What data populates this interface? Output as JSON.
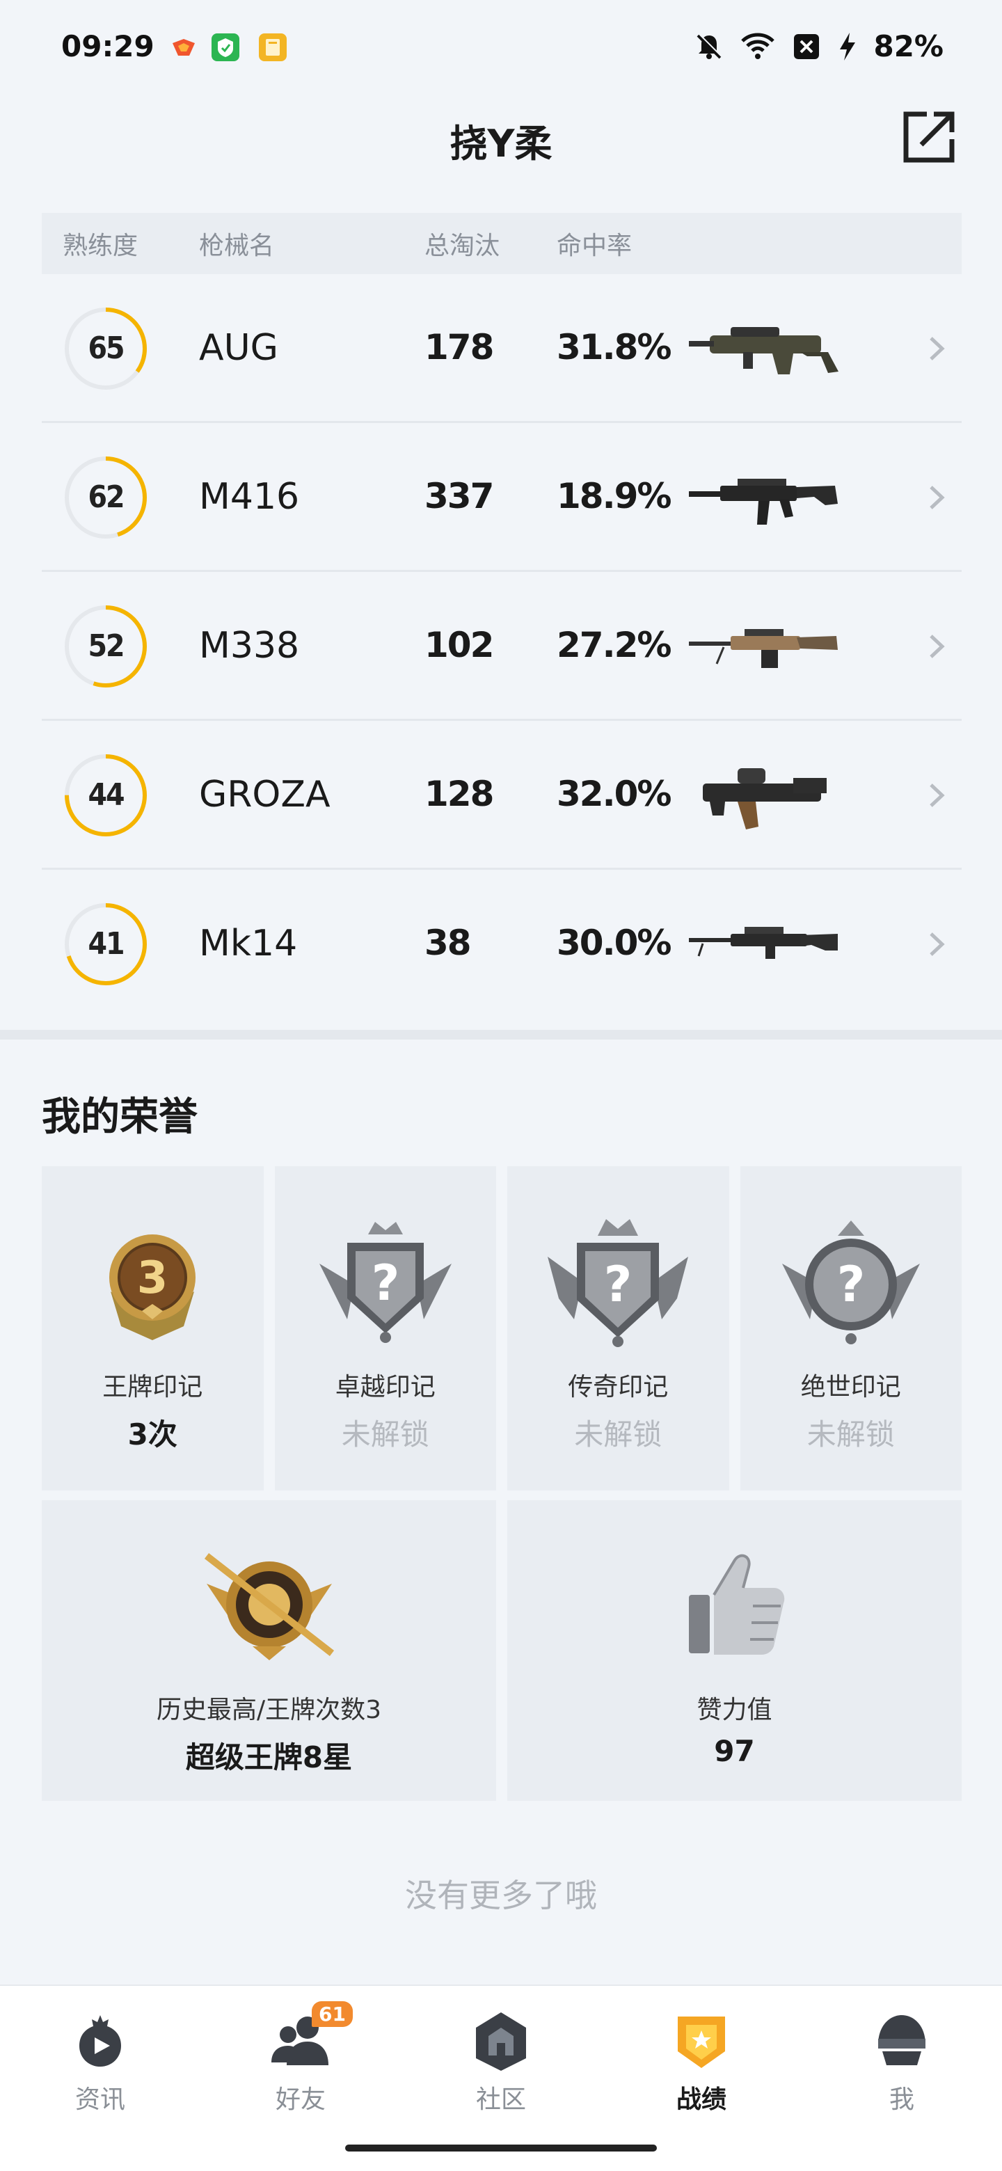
{
  "status_bar": {
    "time": "09:29",
    "battery": "82%",
    "icons": [
      "game-app-icon",
      "security-app-icon",
      "book-app-icon",
      "mute-icon",
      "wifi-icon",
      "sim-icon",
      "charging-icon"
    ]
  },
  "header": {
    "title": "挠Y柔",
    "share_icon": "share-icon"
  },
  "weapon_table": {
    "headers": [
      "熟练度",
      "枪械名",
      "总淘汰",
      "命中率"
    ],
    "rows": [
      {
        "proficiency": "65",
        "name": "AUG",
        "kills": "178",
        "hit_rate": "31.8%",
        "progress": 0.35
      },
      {
        "proficiency": "62",
        "name": "M416",
        "kills": "337",
        "hit_rate": "18.9%",
        "progress": 0.45
      },
      {
        "proficiency": "52",
        "name": "M338",
        "kills": "102",
        "hit_rate": "27.2%",
        "progress": 0.55
      },
      {
        "proficiency": "44",
        "name": "GROZA",
        "kills": "128",
        "hit_rate": "32.0%",
        "progress": 0.75
      },
      {
        "proficiency": "41",
        "name": "Mk14",
        "kills": "38",
        "hit_rate": "30.0%",
        "progress": 0.7
      }
    ]
  },
  "honors": {
    "title": "我的荣誉",
    "badges": [
      {
        "name": "王牌印记",
        "status": "3次",
        "locked": false
      },
      {
        "name": "卓越印记",
        "status": "未解锁",
        "locked": true
      },
      {
        "name": "传奇印记",
        "status": "未解锁",
        "locked": true
      },
      {
        "name": "绝世印记",
        "status": "未解锁",
        "locked": true
      }
    ],
    "highest": {
      "label": "历史最高/王牌次数3",
      "value": "超级王牌8星"
    },
    "likes": {
      "label": "赞力值",
      "value": "97"
    }
  },
  "footer_text": "没有更多了哦",
  "bottom_nav": {
    "items": [
      {
        "label": "资讯",
        "icon": "news-icon",
        "active": false
      },
      {
        "label": "好友",
        "icon": "friends-icon",
        "active": false,
        "badge": "61"
      },
      {
        "label": "社区",
        "icon": "community-icon",
        "active": false
      },
      {
        "label": "战绩",
        "icon": "record-icon",
        "active": true
      },
      {
        "label": "我",
        "icon": "profile-icon",
        "active": false
      }
    ]
  },
  "colors": {
    "accent": "#f5b400",
    "background": "#f2f5f9",
    "card": "#e9edf2",
    "muted": "#8a9099"
  }
}
